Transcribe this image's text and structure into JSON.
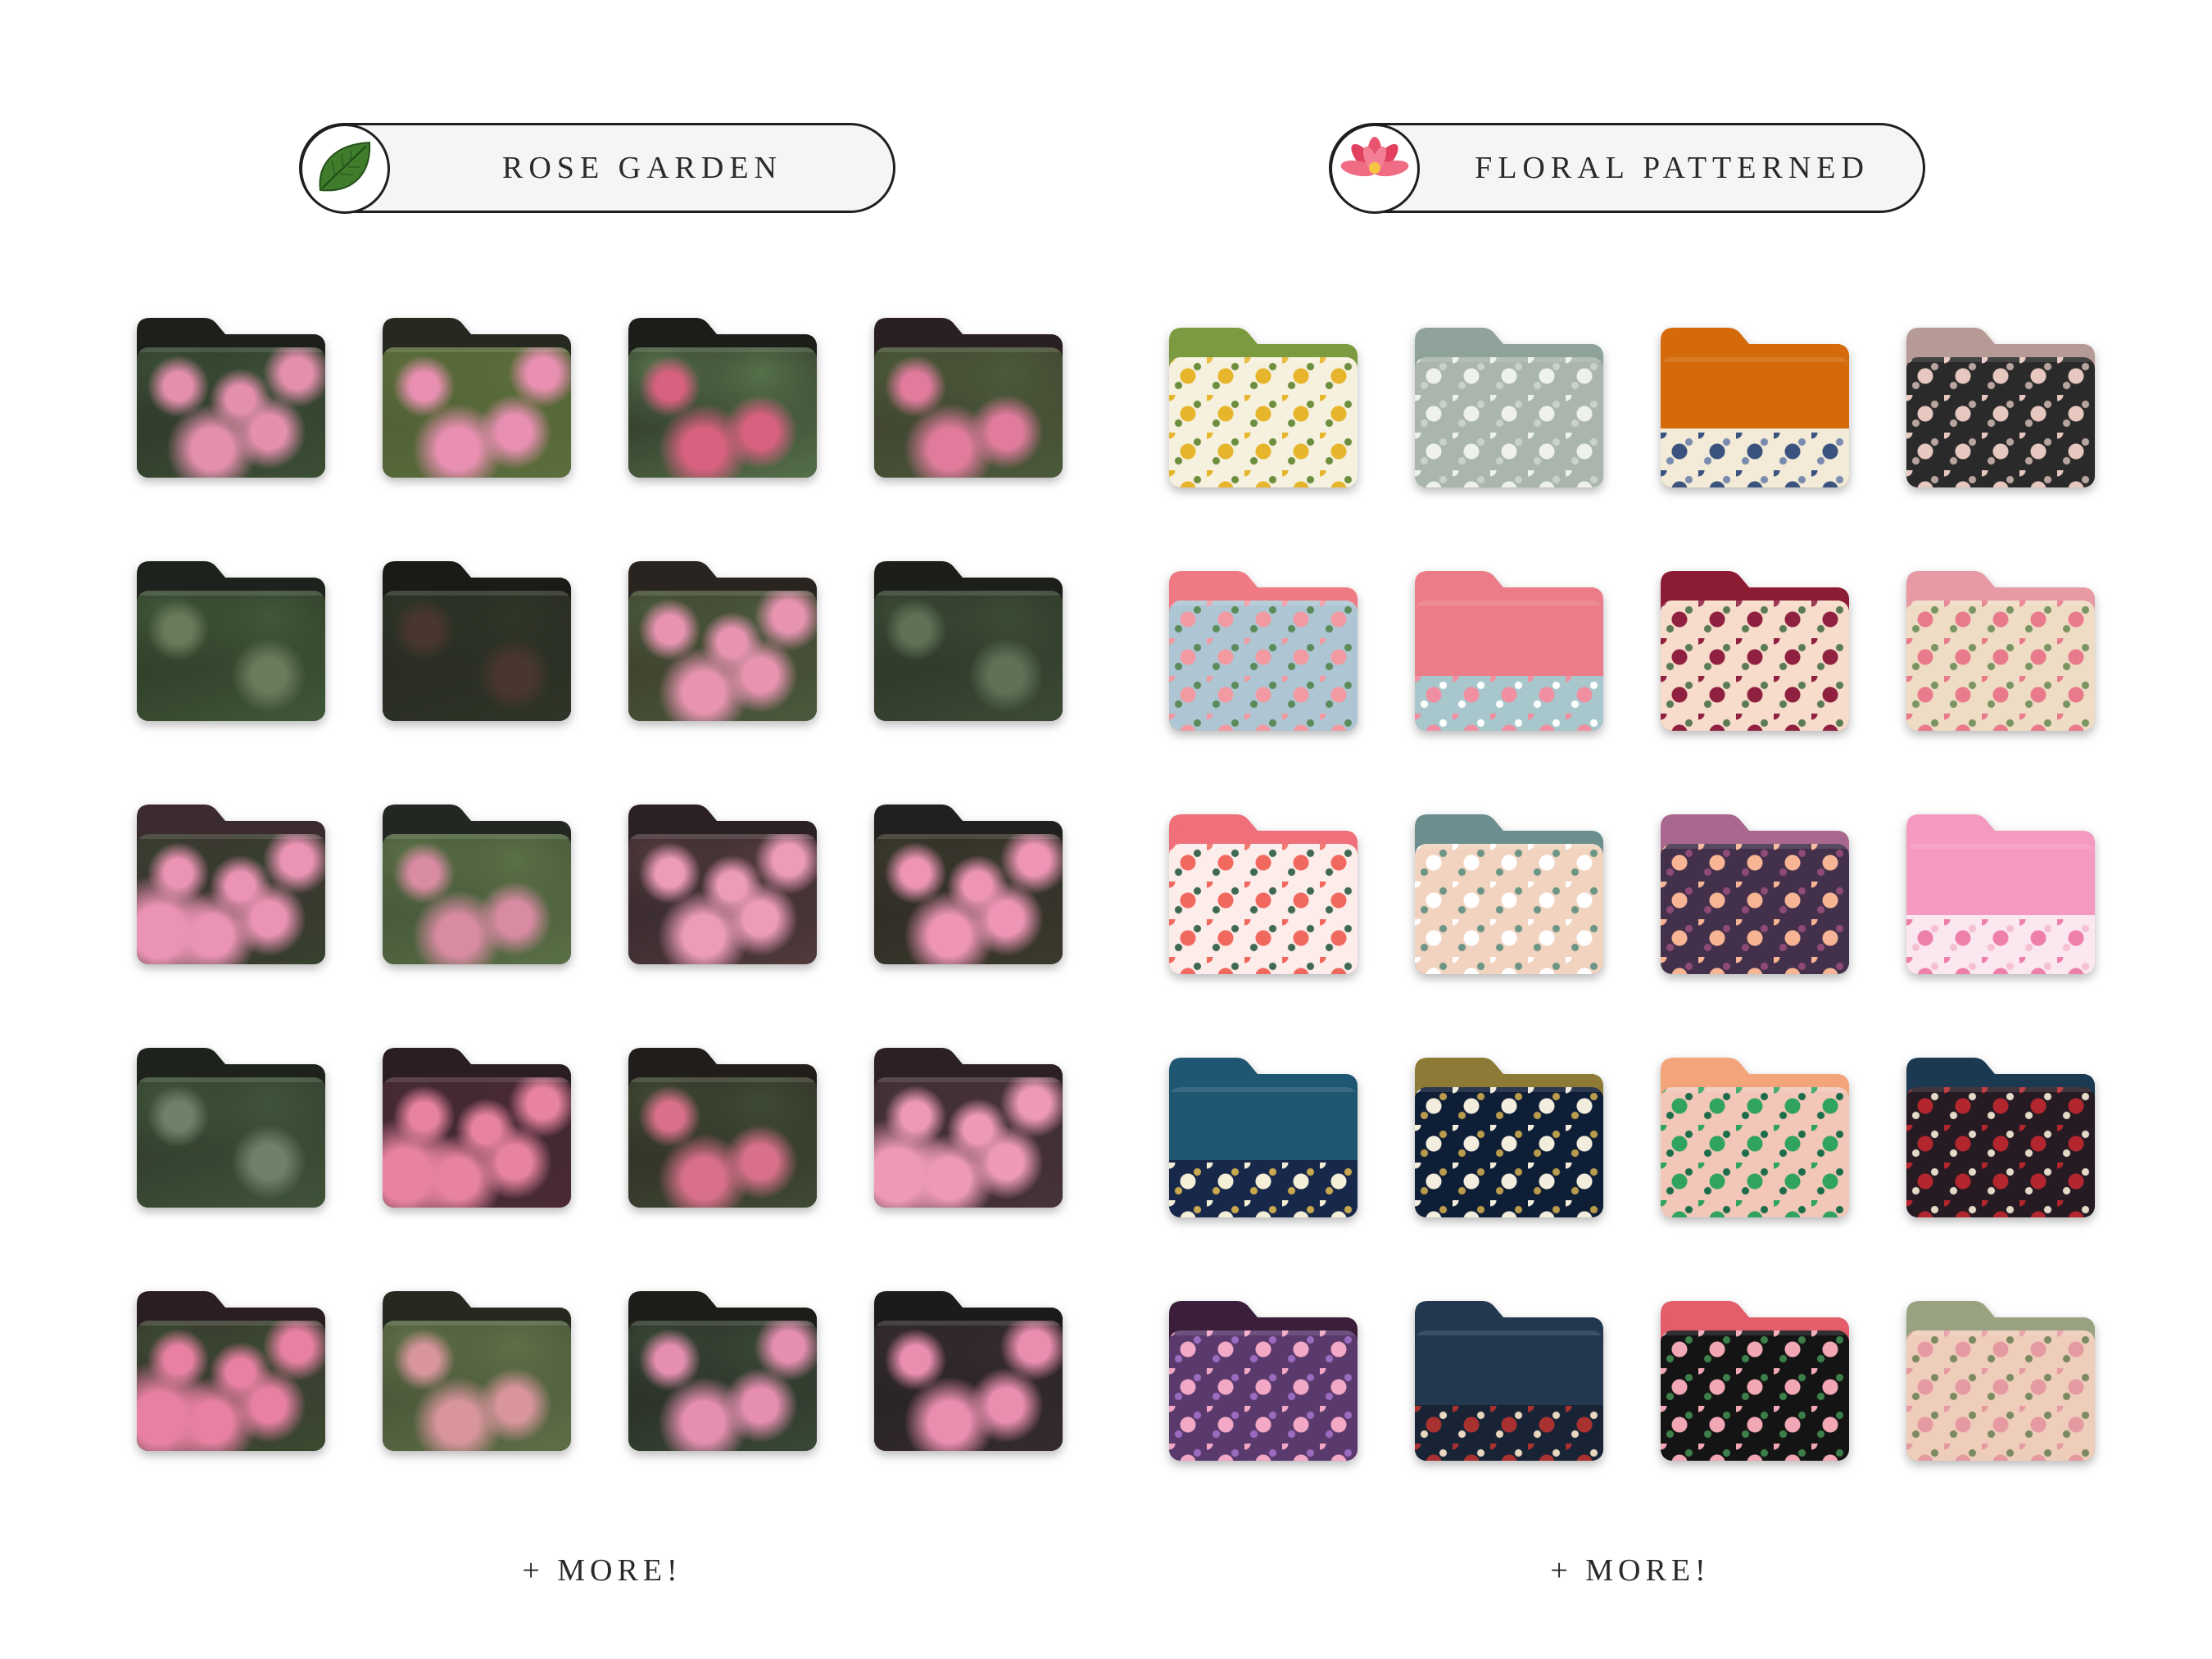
{
  "sections": [
    {
      "title": "ROSE GARDEN",
      "badge_icon": "leaf-icon",
      "more_label": "+ MORE!",
      "folders": [
        {
          "tab": "#1d1f1a",
          "bg": "#2a2e25",
          "petal": "#e58fae",
          "leaf": "#3b4f35",
          "mix": 0.55
        },
        {
          "tab": "#25291f",
          "bg": "#4a5a33",
          "petal": "#e98fb1",
          "leaf": "#5c6e3b",
          "mix": 0.45
        },
        {
          "tab": "#1b1d18",
          "bg": "#22251e",
          "petal": "#d8617f",
          "leaf": "#55704a",
          "mix": 0.2
        },
        {
          "tab": "#2a1f21",
          "bg": "#3b3a2c",
          "petal": "#e07b9c",
          "leaf": "#4b5a3a",
          "mix": 0.25
        },
        {
          "tab": "#1e221d",
          "bg": "#26301f",
          "petal": "#6a7a5c",
          "leaf": "#40583a",
          "mix": 0.05
        },
        {
          "tab": "#1a1a17",
          "bg": "#25261f",
          "petal": "#4a3630",
          "leaf": "#2f3527",
          "mix": 0.05
        },
        {
          "tab": "#2a2421",
          "bg": "#3a3424",
          "petal": "#e894b1",
          "leaf": "#4a5a3d",
          "mix": 0.6
        },
        {
          "tab": "#1c1e1a",
          "bg": "#272c22",
          "petal": "#5f7257",
          "leaf": "#3c4b35",
          "mix": 0.05
        },
        {
          "tab": "#3b2a2e",
          "bg": "#402832",
          "petal": "#eb93b4",
          "leaf": "#37412e",
          "mix": 0.8
        },
        {
          "tab": "#232721",
          "bg": "#3a4a34",
          "petal": "#d98ba2",
          "leaf": "#5a7046",
          "mix": 0.2
        },
        {
          "tab": "#2b2024",
          "bg": "#2c2227",
          "petal": "#ec9bb8",
          "leaf": "#503a3c",
          "mix": 0.55
        },
        {
          "tab": "#22201f",
          "bg": "#2a2521",
          "petal": "#ee95b6",
          "leaf": "#3b3a2d",
          "mix": 0.65
        },
        {
          "tab": "#1e221c",
          "bg": "#2a3326",
          "petal": "#70806a",
          "leaf": "#40543a",
          "mix": 0.05
        },
        {
          "tab": "#2a1e22",
          "bg": "#35262d",
          "petal": "#e7839f",
          "leaf": "#4a2a35",
          "mix": 0.85
        },
        {
          "tab": "#211d1b",
          "bg": "#2b2520",
          "petal": "#d9708a",
          "leaf": "#3f4a33",
          "mix": 0.25
        },
        {
          "tab": "#2c2024",
          "bg": "#3a2730",
          "petal": "#ee9ab7",
          "leaf": "#45323a",
          "mix": 0.8
        },
        {
          "tab": "#2a1e22",
          "bg": "#3a2a30",
          "petal": "#e780a2",
          "leaf": "#3b4a30",
          "mix": 0.75
        },
        {
          "tab": "#25291f",
          "bg": "#3e4a31",
          "petal": "#d9959c",
          "leaf": "#5f6f48",
          "mix": 0.2
        },
        {
          "tab": "#1c1c18",
          "bg": "#222320",
          "petal": "#e58eb0",
          "leaf": "#394835",
          "mix": 0.4
        },
        {
          "tab": "#1c1a1a",
          "bg": "#211f1e",
          "petal": "#ea8eb0",
          "leaf": "#352b2d",
          "mix": 0.45
        }
      ]
    },
    {
      "title": "FLORAL PATTERNED",
      "badge_icon": "lotus-flower-icon",
      "more_label": "+ MORE!",
      "folders": [
        {
          "tab": "#7c9a3f",
          "bg": "#f6f1de",
          "motif": "#e6b52b",
          "leaf": "#6d8e3e",
          "split": 0
        },
        {
          "tab": "#8fa39a",
          "bg": "#a9b5ad",
          "motif": "#eef1ec",
          "leaf": "#c9d1c8",
          "split": 0
        },
        {
          "tab": "#d46a0a",
          "bg": "#f3ead7",
          "motif": "#39527e",
          "leaf": "#7a8bb0",
          "split": 0.55
        },
        {
          "tab": "#b69a95",
          "bg": "#2b2a2a",
          "motif": "#e7c8c0",
          "leaf": "#b9a59f",
          "split": 0
        },
        {
          "tab": "#f07a83",
          "bg": "#aec6d3",
          "motif": "#f19aa2",
          "leaf": "#5b8b5a",
          "split": 0
        },
        {
          "tab": "#ec7d88",
          "bg": "#a7c7cc",
          "motif": "#f08fa1",
          "leaf": "#ffffff",
          "split": 0.58
        },
        {
          "tab": "#8c1b34",
          "bg": "#f7dccb",
          "motif": "#8f2040",
          "leaf": "#5b7b55",
          "split": 0
        },
        {
          "tab": "#e79aa3",
          "bg": "#efdcc4",
          "motif": "#e87a8b",
          "leaf": "#7a9462",
          "split": 0
        },
        {
          "tab": "#ef6f7a",
          "bg": "#fcecea",
          "motif": "#f0685e",
          "leaf": "#3f6a51",
          "split": 0
        },
        {
          "tab": "#6a8f8e",
          "bg": "#f1d3bf",
          "motif": "#ffffff",
          "leaf": "#6c9585",
          "split": 0
        },
        {
          "tab": "#a9698e",
          "bg": "#43304a",
          "motif": "#f7b595",
          "leaf": "#8d4b76",
          "split": 0
        },
        {
          "tab": "#f49ac1",
          "bg": "#fbe7ef",
          "motif": "#ee7fa9",
          "leaf": "#f6c0d4",
          "split": 0.55
        },
        {
          "tab": "#1f5672",
          "bg": "#17284a",
          "motif": "#f5efd8",
          "leaf": "#c8a94f",
          "split": 0.56
        },
        {
          "tab": "#8c7a36",
          "bg": "#0f1e37",
          "motif": "#f2eddc",
          "leaf": "#b99b4d",
          "split": 0
        },
        {
          "tab": "#f3a47a",
          "bg": "#f2c7b9",
          "motif": "#2fa35f",
          "leaf": "#1e6d4a",
          "split": 0
        },
        {
          "tab": "#1b3a52",
          "bg": "#261a23",
          "motif": "#b3262d",
          "leaf": "#e5d9c8",
          "split": 0
        },
        {
          "tab": "#3b1f3a",
          "bg": "#5a3a6d",
          "motif": "#f3a8c5",
          "leaf": "#9b6bbf",
          "split": 0
        },
        {
          "tab": "#22384f",
          "bg": "#182336",
          "motif": "#a93230",
          "leaf": "#e8d6bf",
          "split": 0.57
        },
        {
          "tab": "#e35d6a",
          "bg": "#141414",
          "motif": "#f2a7b4",
          "leaf": "#3d7f4a",
          "split": 0
        },
        {
          "tab": "#9aa381",
          "bg": "#efcdbb",
          "motif": "#e59aa2",
          "leaf": "#7b8a60",
          "split": 0
        }
      ]
    }
  ]
}
